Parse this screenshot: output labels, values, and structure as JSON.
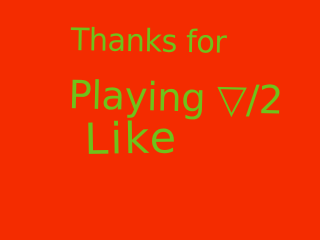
{
  "stage": {
    "background_color": "#f42c00",
    "text_color": "#6fc21a"
  },
  "message": {
    "line1": "Thanks for",
    "line2": "Playing ▽/2",
    "line3": "Like"
  }
}
